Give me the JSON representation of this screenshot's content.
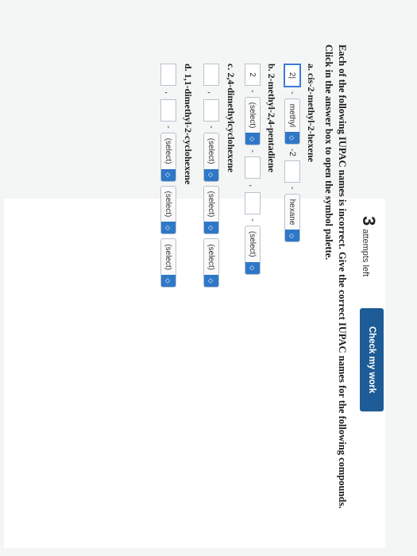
{
  "header": {
    "attempts_count": "3",
    "attempts_label": "attempts left",
    "check_button": "Check my work"
  },
  "instructions": "Each of the following IUPAC names is incorrect. Give the correct IUPAC names for the following compounds. Click in the answer box to open the symbol palette.",
  "questions": {
    "a": {
      "label": "a. cis-2-methyl-2-hexene",
      "box1": "2|",
      "select1": "methyl",
      "after1": "-2",
      "select2": "hexane"
    },
    "b": {
      "label": "b. 2-methyl-2,4-pentadiene",
      "box1": "2",
      "select1": "(select)",
      "select2": "(select)"
    },
    "c": {
      "label": "c. 2,4-dimethylcyclohexene",
      "select1": "(select)",
      "select2": "(select)",
      "select3": "(select)"
    },
    "d": {
      "label": "d. 1,1-dimethyl-2-cyclohexene",
      "select1": "(select)",
      "select2": "(select)",
      "select3": "(select)"
    }
  },
  "symbols": {
    "dash": "-",
    "comma": ",",
    "arrow": "◇"
  },
  "colors": {
    "button": "#1d5c96",
    "select_arrow": "#2f78c7",
    "active_box": "#3b7bd6"
  }
}
